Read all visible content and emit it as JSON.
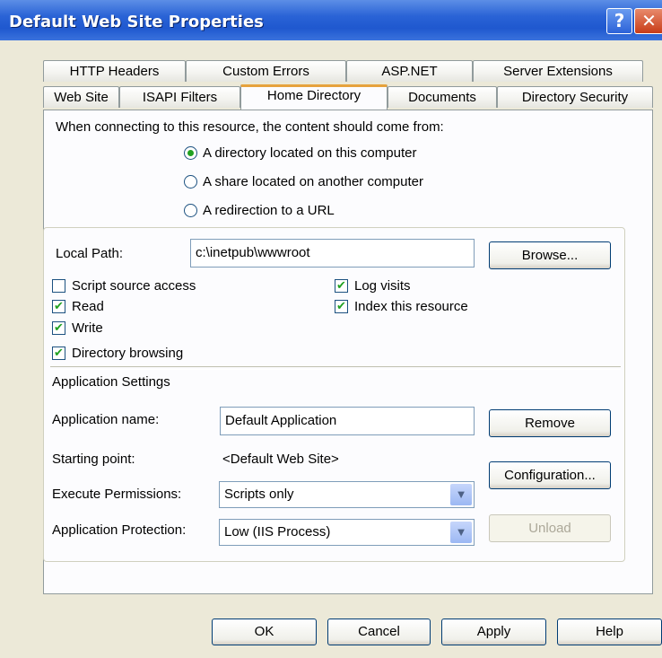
{
  "window": {
    "title": "Default Web Site Properties",
    "help_glyph": "?",
    "close_glyph": "✕"
  },
  "tabs": {
    "row1": [
      "HTTP Headers",
      "Custom Errors",
      "ASP.NET",
      "Server Extensions"
    ],
    "row2": [
      "Web Site",
      "ISAPI Filters",
      "Home Directory",
      "Documents",
      "Directory Security"
    ],
    "active": "Home Directory"
  },
  "content_source": {
    "prompt": "When connecting to this resource, the content should come from:",
    "options": [
      "A directory located on this computer",
      "A share located on another computer",
      "A redirection to a URL"
    ],
    "selected_index": 0
  },
  "local_path": {
    "label": "Local Path:",
    "value": "c:\\inetpub\\wwwroot",
    "browse_label": "Browse..."
  },
  "checkboxes": {
    "script_source": {
      "label": "Script source access",
      "checked": false
    },
    "read": {
      "label": "Read",
      "checked": true
    },
    "write": {
      "label": "Write",
      "checked": true
    },
    "dir_browsing": {
      "label": "Directory browsing",
      "checked": true
    },
    "log_visits": {
      "label": "Log visits",
      "checked": true
    },
    "index_resource": {
      "label": "Index this resource",
      "checked": true
    }
  },
  "check_glyph": "✔",
  "app_settings": {
    "heading": "Application Settings",
    "name_label": "Application name:",
    "name_value": "Default Application",
    "remove_label": "Remove",
    "start_label": "Starting point:",
    "start_value": "<Default Web Site>",
    "config_label": "Configuration...",
    "exec_label": "Execute Permissions:",
    "exec_value": "Scripts only",
    "protect_label": "Application Protection:",
    "protect_value": "Low (IIS Process)",
    "unload_label": "Unload",
    "dropdown_glyph": "▼"
  },
  "footer": {
    "ok": "OK",
    "cancel": "Cancel",
    "apply": "Apply",
    "help": "Help"
  }
}
